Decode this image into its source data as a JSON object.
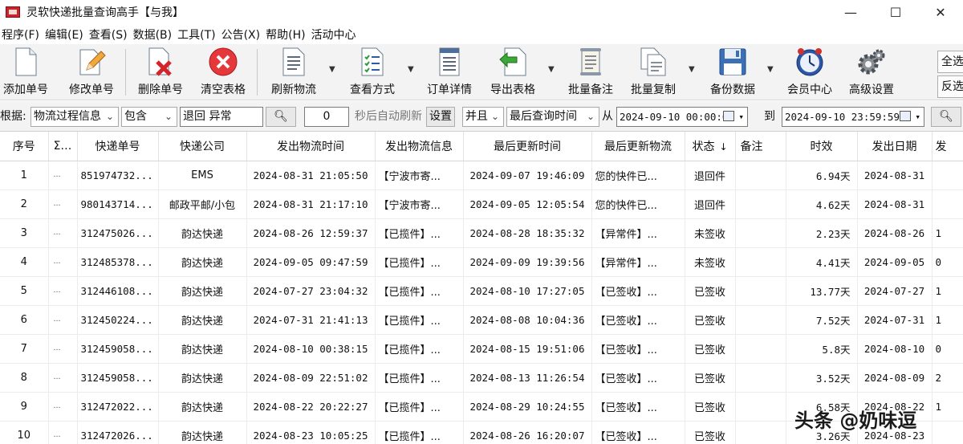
{
  "window": {
    "title": "灵软快递批量查询高手【与我】",
    "minimize": "—",
    "maximize": "☐",
    "close": "✕"
  },
  "menu": [
    "程序(F)",
    "编辑(E)",
    "查看(S)",
    "数据(B)",
    "工具(T)",
    "公告(X)",
    "帮助(H)",
    "活动中心"
  ],
  "toolbar": {
    "add": "添加单号",
    "edit": "修改单号",
    "delete": "删除单号",
    "clear": "清空表格",
    "refresh": "刷新物流",
    "view_mode": "查看方式",
    "order_detail": "订单详情",
    "export": "导出表格",
    "batch_note": "批量备注",
    "batch_copy": "批量复制",
    "backup": "备份数据",
    "member": "会员中心",
    "advanced": "高级设置",
    "select_all": "全选",
    "invert_select": "反选"
  },
  "filter": {
    "by_label": "根据:",
    "field": "物流过程信息",
    "operator": "包含",
    "keyword": "退回 异常",
    "refresh_seconds": "0",
    "auto_refresh_label": "秒后自动刷新",
    "settings": "设置",
    "logic": "并且",
    "time_field": "最后查询时间",
    "from_label": "从",
    "from_date": "2024-09-10 00:00:00",
    "to_label": "到",
    "to_date": "2024-09-10 23:59:59"
  },
  "table": {
    "headers": [
      "序号",
      "Σ…",
      "快递单号",
      "快递公司",
      "发出物流时间",
      "发出物流信息",
      "最后更新时间",
      "最后更新物流",
      "状态",
      "备注",
      "时效",
      "发出日期",
      "发"
    ],
    "status_sort_icon": "↓",
    "rows": [
      {
        "no": "1",
        "dots": "…",
        "tracking": "851974732...",
        "company": "EMS",
        "sent_time": "2024-08-31 21:05:50",
        "sent_info": "【宁波市寄...",
        "last_time": "2024-09-07 19:46:09",
        "last_info": "您的快件已...",
        "status": "退回件",
        "note": "",
        "duration": "6.94天",
        "sent_date": "2024-08-31",
        "extra": ""
      },
      {
        "no": "2",
        "dots": "…",
        "tracking": "980143714...",
        "company": "邮政平邮/小包",
        "sent_time": "2024-08-31 21:17:10",
        "sent_info": "【宁波市寄...",
        "last_time": "2024-09-05 12:05:54",
        "last_info": "您的快件已...",
        "status": "退回件",
        "note": "",
        "duration": "4.62天",
        "sent_date": "2024-08-31",
        "extra": ""
      },
      {
        "no": "3",
        "dots": "…",
        "tracking": "312475026...",
        "company": "韵达快递",
        "sent_time": "2024-08-26 12:59:37",
        "sent_info": "【已揽件】...",
        "last_time": "2024-08-28 18:35:32",
        "last_info": "【异常件】...",
        "status": "未签收",
        "note": "",
        "duration": "2.23天",
        "sent_date": "2024-08-26",
        "extra": "1"
      },
      {
        "no": "4",
        "dots": "…",
        "tracking": "312485378...",
        "company": "韵达快递",
        "sent_time": "2024-09-05 09:47:59",
        "sent_info": "【已揽件】...",
        "last_time": "2024-09-09 19:39:56",
        "last_info": "【异常件】...",
        "status": "未签收",
        "note": "",
        "duration": "4.41天",
        "sent_date": "2024-09-05",
        "extra": "0"
      },
      {
        "no": "5",
        "dots": "…",
        "tracking": "312446108...",
        "company": "韵达快递",
        "sent_time": "2024-07-27 23:04:32",
        "sent_info": "【已揽件】...",
        "last_time": "2024-08-10 17:27:05",
        "last_info": "【已签收】...",
        "status": "已签收",
        "note": "",
        "duration": "13.77天",
        "sent_date": "2024-07-27",
        "extra": "1"
      },
      {
        "no": "6",
        "dots": "…",
        "tracking": "312450224...",
        "company": "韵达快递",
        "sent_time": "2024-07-31 21:41:13",
        "sent_info": "【已揽件】...",
        "last_time": "2024-08-08 10:04:36",
        "last_info": "【已签收】...",
        "status": "已签收",
        "note": "",
        "duration": "7.52天",
        "sent_date": "2024-07-31",
        "extra": "1"
      },
      {
        "no": "7",
        "dots": "…",
        "tracking": "312459058...",
        "company": "韵达快递",
        "sent_time": "2024-08-10 00:38:15",
        "sent_info": "【已揽件】...",
        "last_time": "2024-08-15 19:51:06",
        "last_info": "【已签收】...",
        "status": "已签收",
        "note": "",
        "duration": "5.8天",
        "sent_date": "2024-08-10",
        "extra": "0"
      },
      {
        "no": "8",
        "dots": "…",
        "tracking": "312459058...",
        "company": "韵达快递",
        "sent_time": "2024-08-09 22:51:02",
        "sent_info": "【已揽件】...",
        "last_time": "2024-08-13 11:26:54",
        "last_info": "【已签收】...",
        "status": "已签收",
        "note": "",
        "duration": "3.52天",
        "sent_date": "2024-08-09",
        "extra": "2"
      },
      {
        "no": "9",
        "dots": "…",
        "tracking": "312472022...",
        "company": "韵达快递",
        "sent_time": "2024-08-22 20:22:27",
        "sent_info": "【已揽件】...",
        "last_time": "2024-08-29 10:24:55",
        "last_info": "【已签收】...",
        "status": "已签收",
        "note": "",
        "duration": "6.58天",
        "sent_date": "2024-08-22",
        "extra": "1"
      },
      {
        "no": "10",
        "dots": "…",
        "tracking": "312472026...",
        "company": "韵达快递",
        "sent_time": "2024-08-23 10:05:25",
        "sent_info": "【已揽件】...",
        "last_time": "2024-08-26 16:20:07",
        "last_info": "【已签收】...",
        "status": "已签收",
        "note": "",
        "duration": "3.26天",
        "sent_date": "2024-08-23",
        "extra": ""
      }
    ]
  },
  "watermark": "头条 @奶味逗"
}
